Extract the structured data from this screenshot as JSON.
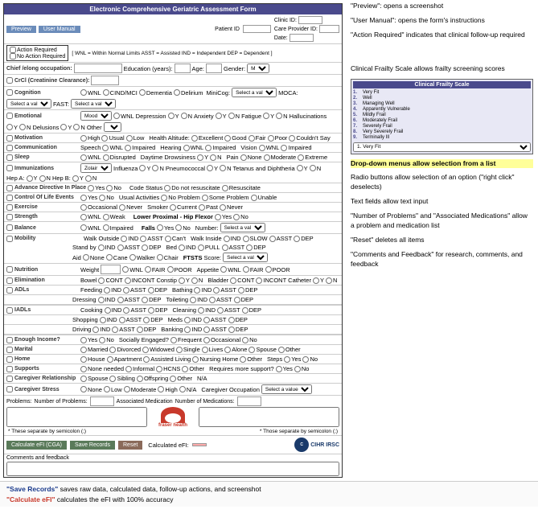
{
  "form": {
    "title": "Electronic Comprehensive Geriatric Assessment Form",
    "buttons": {
      "preview": "Preview",
      "user_manual": "User Manual"
    },
    "patient": {
      "id_label": "Patient ID",
      "clinic_id_label": "Clinic ID:",
      "care_provider_label": "Care Provider ID:",
      "date_label": "Date:"
    },
    "action_required": {
      "wnl_label": "[ WNL = Within Normal Limits  ASST = Assisted  IND = Independent  DEP = Dependent ]",
      "action_label": "Action Required",
      "no_action_label": "No Action Required",
      "chief_label": "Chief /elong occupation:",
      "education_label": "Education (years):",
      "age_label": "Age:",
      "gender_label": "Gender:"
    },
    "sections": {
      "crcl": "CrCl (Creatinine Clearance):",
      "cognition": "Cognition",
      "emotional": "Emotional",
      "motivation": "Motivation",
      "communication": "Communication",
      "sleep": "Sleep",
      "immunizations": "Immunizations",
      "advance_directive": "Advance Directive In Place",
      "control_life": "Control Of Life Events",
      "exercise": "Exercise",
      "strength": "Strength",
      "balance": "Balance",
      "mobility": "Mobility",
      "nutrition": "Nutrition",
      "elimination": "Elimination",
      "adls": "ADLs",
      "iadls": "IADLs",
      "enough_income": "Enough Income?",
      "marital": "Marital",
      "home": "Home",
      "supports": "Supports",
      "caregiver_relationship": "Caregiver Relationship",
      "caregiver_stress": "Caregiver Stress"
    },
    "frailty_scale": {
      "title": "Clinical Frailty Scale",
      "items": [
        {
          "num": "1",
          "text": "Very Fit"
        },
        {
          "num": "2",
          "text": "Well"
        },
        {
          "num": "3",
          "text": "Managing Well"
        },
        {
          "num": "4",
          "text": "Apparently Vulnerable"
        },
        {
          "num": "5",
          "text": "Mildly Frail"
        },
        {
          "num": "6",
          "text": "Moderately Frail"
        },
        {
          "num": "7",
          "text": "Severely Frail"
        },
        {
          "num": "8",
          "text": "Very Severely Frail"
        },
        {
          "num": "9",
          "text": "Terminally Ill"
        }
      ]
    },
    "bottom": {
      "problems_label": "Problems:",
      "num_problems_label": "Number of Problems:",
      "assoc_med_label": "Associated Medication",
      "num_med_label": "Number of Medications:",
      "calculated_efi_label": "Calculated eFI:",
      "btn_calculate": "Calculate eFI (CGA)",
      "btn_save": "Save Records",
      "btn_reset": "Reset",
      "comments_label": "Comments and feedback",
      "separate_label": "* These separate by semicolon (;)",
      "separate_label2": "* Those separate by semicolon (;)"
    },
    "logos": {
      "fraser_health": "fraser health",
      "cihr": "CIHR IRSC"
    }
  },
  "annotations": {
    "preview_note": "\"Preview\": opens a screenshot",
    "user_manual_note": "\"User Manual\": opens the form's instructions",
    "action_required_note": "\"Action Required\" indicates that clinical follow-up required",
    "frailty_note": "Clinical Frailty Scale allows frailty screening scores",
    "dropdown_note": "Drop-down menus allow selection from a list",
    "radio_note": "Radio buttons allow selection of an option (\"right click\" deselects)",
    "text_fields_note": "Text fields allow text input",
    "problems_note": "\"Number of Problems\" and \"Associated Medications\" allow a problem and medication list",
    "reset_note": "\"Reset\" deletes all items",
    "comments_note": "\"Comments and Feedback\" for research, comments, and feedback",
    "save_note": "\"Save Records\" saves raw data, calculated data, follow-up actions, and screenshot",
    "calculate_note": "\"Calculate eFI\" calculates the eFI with 100% accuracy"
  }
}
